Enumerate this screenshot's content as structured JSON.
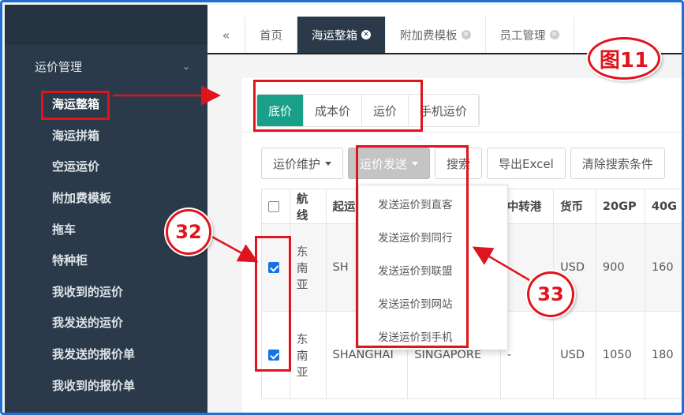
{
  "sidebar": {
    "group_label": "运价管理",
    "items": [
      {
        "label": "海运整箱"
      },
      {
        "label": "海运拼箱"
      },
      {
        "label": "空运运价"
      },
      {
        "label": "附加费模板"
      },
      {
        "label": "拖车"
      },
      {
        "label": "特种柜"
      },
      {
        "label": "我收到的运价"
      },
      {
        "label": "我发送的运价"
      },
      {
        "label": "我发送的报价单"
      },
      {
        "label": "我收到的报价单"
      }
    ]
  },
  "tabs": [
    {
      "label": "首页"
    },
    {
      "label": "海运整箱"
    },
    {
      "label": "附加费模板"
    },
    {
      "label": "员工管理"
    }
  ],
  "price_tabs": [
    "底价",
    "成本价",
    "运价",
    "手机运价"
  ],
  "toolbar": {
    "maintain": "运价维护",
    "send": "运价发送",
    "search": "搜索",
    "export": "导出Excel",
    "clear": "清除搜索条件"
  },
  "table": {
    "headers": [
      "",
      "航线",
      "起运",
      "",
      "中转港",
      "货币",
      "20GP",
      "40G"
    ],
    "rows": [
      {
        "route": "东南亚",
        "origin": "SH",
        "dest": "",
        "transit": "",
        "currency": "USD",
        "gp20": "900",
        "gp40": "160"
      },
      {
        "route": "东南亚",
        "origin": "SHANGHAI",
        "dest": "SINGAPORE",
        "transit": "-",
        "currency": "USD",
        "gp20": "1050",
        "gp40": "180"
      }
    ]
  },
  "dropdown": [
    "发送运价到直客",
    "发送运价到同行",
    "发送运价到联盟",
    "发送运价到网站",
    "发送运价到手机"
  ],
  "annotations": {
    "figure": "图11",
    "badge_a": "32",
    "badge_b": "33"
  },
  "colors": {
    "sidebar": "#2a3a4a",
    "accent": "#1aa089",
    "annotation": "#e0141d",
    "checkbox": "#1673e6"
  }
}
